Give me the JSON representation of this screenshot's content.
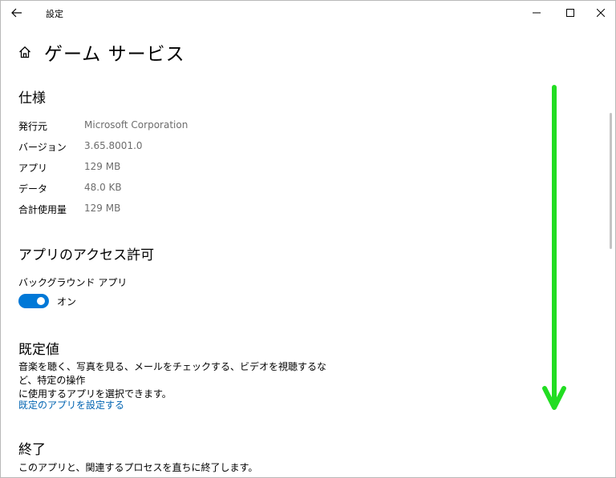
{
  "window": {
    "title": "設定",
    "icons": {
      "back": "back-arrow-icon",
      "minimize": "minimize-icon",
      "maximize": "maximize-icon",
      "close": "close-icon"
    }
  },
  "page": {
    "title": "ゲーム サービス",
    "icon": "home-icon"
  },
  "specs": {
    "title": "仕様",
    "rows": [
      {
        "label": "発行元",
        "value": "Microsoft Corporation"
      },
      {
        "label": "バージョン",
        "value": "3.65.8001.0"
      },
      {
        "label": "アプリ",
        "value": "129 MB"
      },
      {
        "label": "データ",
        "value": "48.0 KB"
      },
      {
        "label": "合計使用量",
        "value": "129 MB"
      }
    ]
  },
  "permissions": {
    "title": "アプリのアクセス許可",
    "background_label": "バックグラウンド アプリ",
    "toggle_state": "オン",
    "toggle_on": true,
    "toggle_color": "#0078d7"
  },
  "defaults": {
    "title": "既定値",
    "description_line1": "音楽を聴く、写真を見る、メールをチェックする、ビデオを視聴するなど、特定の操作",
    "description_line2": "に使用するアプリを選択できます。",
    "link": "既定のアプリを設定する",
    "link_color": "#0063b1"
  },
  "terminate": {
    "title": "終了",
    "description": "このアプリと、関連するプロセスを直ちに終了します。"
  },
  "annotation": {
    "arrow_color": "#22dd22",
    "direction": "down"
  }
}
